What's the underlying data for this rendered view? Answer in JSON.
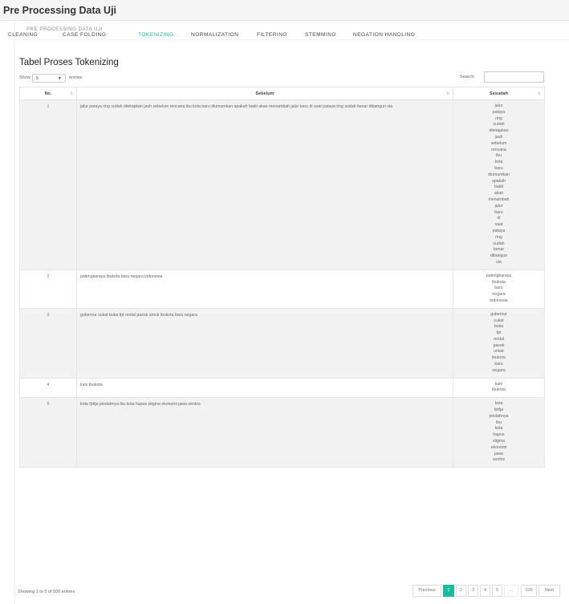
{
  "page": {
    "title": "Pre Processing Data Uji"
  },
  "card": {
    "header": "PRE PROCESSING DATA UJI"
  },
  "tabs": [
    {
      "label": "CLEANING"
    },
    {
      "label": "CASE FOLDING"
    },
    {
      "label": "TOKENIZING"
    },
    {
      "label": "NORMALIZATION"
    },
    {
      "label": "FILTERING"
    },
    {
      "label": "STEMMING"
    },
    {
      "label": "NEGATION HANDLING"
    }
  ],
  "active_tab": "TOKENIZING",
  "table_title": "Tabel Proses Tokenizing",
  "length_menu": {
    "show_label": "Show",
    "value": "5",
    "entries_label": "entries"
  },
  "search": {
    "label": "Search:",
    "value": ""
  },
  "columns": {
    "no": "No.",
    "before": "Sebelum",
    "after": "Sesudah"
  },
  "rows": [
    {
      "no": "1",
      "before": "jalur pataya ring sudah ditetapkan jauh sebelum rencana ibu kota baru diumumkan apakah bakti akan menambah jalur baru di saat pataya ring sudah benar dibangun sla",
      "after": [
        "jalur",
        "pataya",
        "ring",
        "sudah",
        "ditetapkan",
        "jauh",
        "sebelum",
        "rencana",
        "ibu",
        "kota",
        "baru",
        "diumumkan",
        "apakah",
        "bakti",
        "akan",
        "menambah",
        "jalur",
        "baru",
        "di",
        "saat",
        "pataya",
        "ring",
        "sudah",
        "benar",
        "dibangun",
        "sla"
      ]
    },
    {
      "no": "2",
      "before": "palengkaraya ibukota baru negara indonesia",
      "after": [
        "palengkaraya",
        "ibukota",
        "baru",
        "negara",
        "indonesia"
      ]
    },
    {
      "no": "3",
      "before": "gubernur sukat buka fpt rental pasok untuk ibukota baru negara",
      "after": [
        "gubernur",
        "sukat",
        "buka",
        "fpt",
        "rental",
        "pasok",
        "untuk",
        "ibukota",
        "baru",
        "negara"
      ]
    },
    {
      "no": "4",
      "before": "kalo ibukota",
      "after": [
        "kalo",
        "ibukota"
      ]
    },
    {
      "no": "5",
      "before": "kota fpttja pindahnya ibu kota hapus stigma ekonomi jawa sentris",
      "after": [
        "kota",
        "fpttja",
        "pindahnya",
        "ibu",
        "kota",
        "hapus",
        "stigma",
        "ekonomi",
        "jawa",
        "sentris"
      ]
    }
  ],
  "info": "Showing 1 to 5 of 500 entries",
  "pagination": [
    "Previous",
    "1",
    "2",
    "3",
    "4",
    "5",
    "...",
    "100",
    "Next"
  ],
  "active_page": "1",
  "colors": {
    "accent": "#1abc9c"
  }
}
